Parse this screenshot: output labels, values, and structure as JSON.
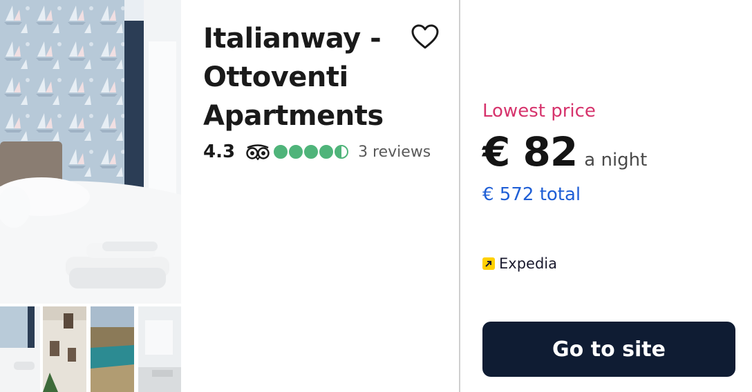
{
  "hotel": {
    "name": "Italianway - Ottoventi Apartments",
    "rating": "4.3",
    "bubble_rating": 4.5,
    "bubble_count": 5,
    "reviews": "3 reviews"
  },
  "favorite": {
    "icon": "heart-outline-icon"
  },
  "price": {
    "label": "Lowest price",
    "amount": "€ 82",
    "per": "a night",
    "total": "€ 572 total"
  },
  "provider": {
    "name": "Expedia",
    "icon": "expedia-logo-icon"
  },
  "cta": {
    "label": "Go to site"
  },
  "colors": {
    "accent_pink": "#d6336c",
    "link_blue": "#1f5fd6",
    "bubble_green": "#4fb47a",
    "cta_navy": "#0f1c33",
    "expedia_yellow": "#ffd000"
  }
}
